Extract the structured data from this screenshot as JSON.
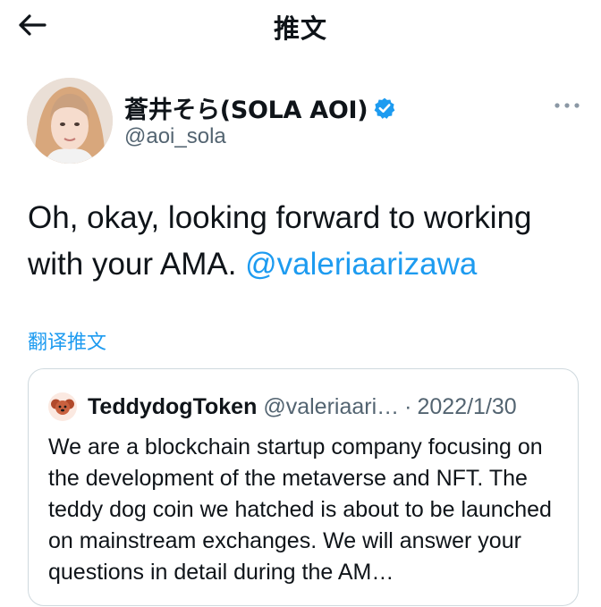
{
  "header": {
    "title": "推文",
    "back_icon": "arrow-left-icon"
  },
  "author": {
    "display_name": "蒼井そら(SOLA AOI)",
    "handle": "@aoi_sola",
    "verified_icon": "verified-badge-icon",
    "more_icon": "more-horizontal-icon"
  },
  "tweet": {
    "text": "Oh, okay, looking forward to working with your AMA.",
    "mention": "@valeriaarizawa",
    "translate_label": "翻译推文"
  },
  "quote": {
    "name": "TeddydogToken",
    "handle": "@valeriaari…",
    "separator": "·",
    "date": "2022/1/30",
    "text": "We are a blockchain startup company focusing on the development of the metaverse and NFT. The teddy dog coin we hatched is about to be launched on mainstream exchanges. We will answer your questions in detail during the AM…"
  },
  "colors": {
    "accent": "#1d9bf0",
    "secondary_text": "#536471",
    "border": "#cfd9de"
  }
}
